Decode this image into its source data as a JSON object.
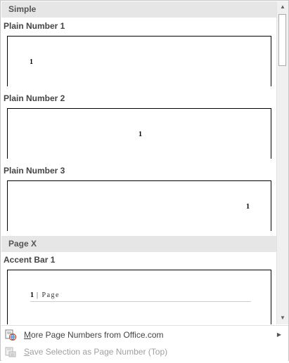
{
  "sections": [
    {
      "header": "Simple",
      "items": [
        {
          "label": "Plain Number 1",
          "preview_text": "1"
        },
        {
          "label": "Plain Number 2",
          "preview_text": "1"
        },
        {
          "label": "Plain Number 3",
          "preview_text": "1"
        }
      ]
    },
    {
      "header": "Page X",
      "items": [
        {
          "label": "Accent Bar 1",
          "preview_num": "1",
          "preview_sep": "|",
          "preview_word": "Page"
        }
      ]
    }
  ],
  "scrollbar": {
    "up_arrow": "▲",
    "down_arrow": "▼"
  },
  "menu": {
    "more_label_u": "M",
    "more_label_rest": "ore Page Numbers from Office.com",
    "more_arrow": "▶",
    "save_label_u": "S",
    "save_label_rest": "ave Selection as Page Number (Top)"
  },
  "colors": {
    "section_header_bg": "#e6e6e6",
    "disabled_text": "#a0a0a0"
  }
}
